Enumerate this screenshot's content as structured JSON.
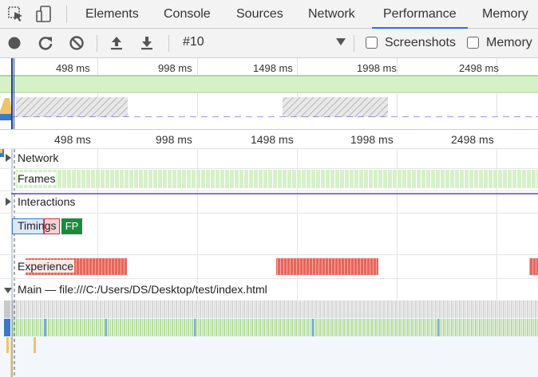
{
  "tabs": {
    "items": [
      {
        "label": "Elements"
      },
      {
        "label": "Console"
      },
      {
        "label": "Sources"
      },
      {
        "label": "Network"
      },
      {
        "label": "Performance",
        "active": true
      },
      {
        "label": "Memory"
      }
    ]
  },
  "toolbar": {
    "profile": "#10",
    "screenshots_label": "Screenshots",
    "memory_label": "Memory"
  },
  "overview": {
    "ticks": [
      "498 ms",
      "998 ms",
      "1498 ms",
      "1998 ms",
      "2498 ms"
    ]
  },
  "ruler": {
    "ticks": [
      "498 ms",
      "998 ms",
      "1498 ms",
      "1998 ms",
      "2498 ms"
    ]
  },
  "tracks": {
    "network": "Network",
    "frames": "Frames",
    "interactions": "Interactions",
    "timings": "Timings",
    "fp": "FP",
    "experience": "Experience",
    "main": "Main — file:///C:/Users/DS/Desktop/test/index.html"
  },
  "colors": {
    "accent": "#1a73e8",
    "frames_green": "#d6f0c8",
    "layout_shift": "#e8655a",
    "interaction_purple": "#8a6be6",
    "fp_green": "#1e8a3e"
  }
}
